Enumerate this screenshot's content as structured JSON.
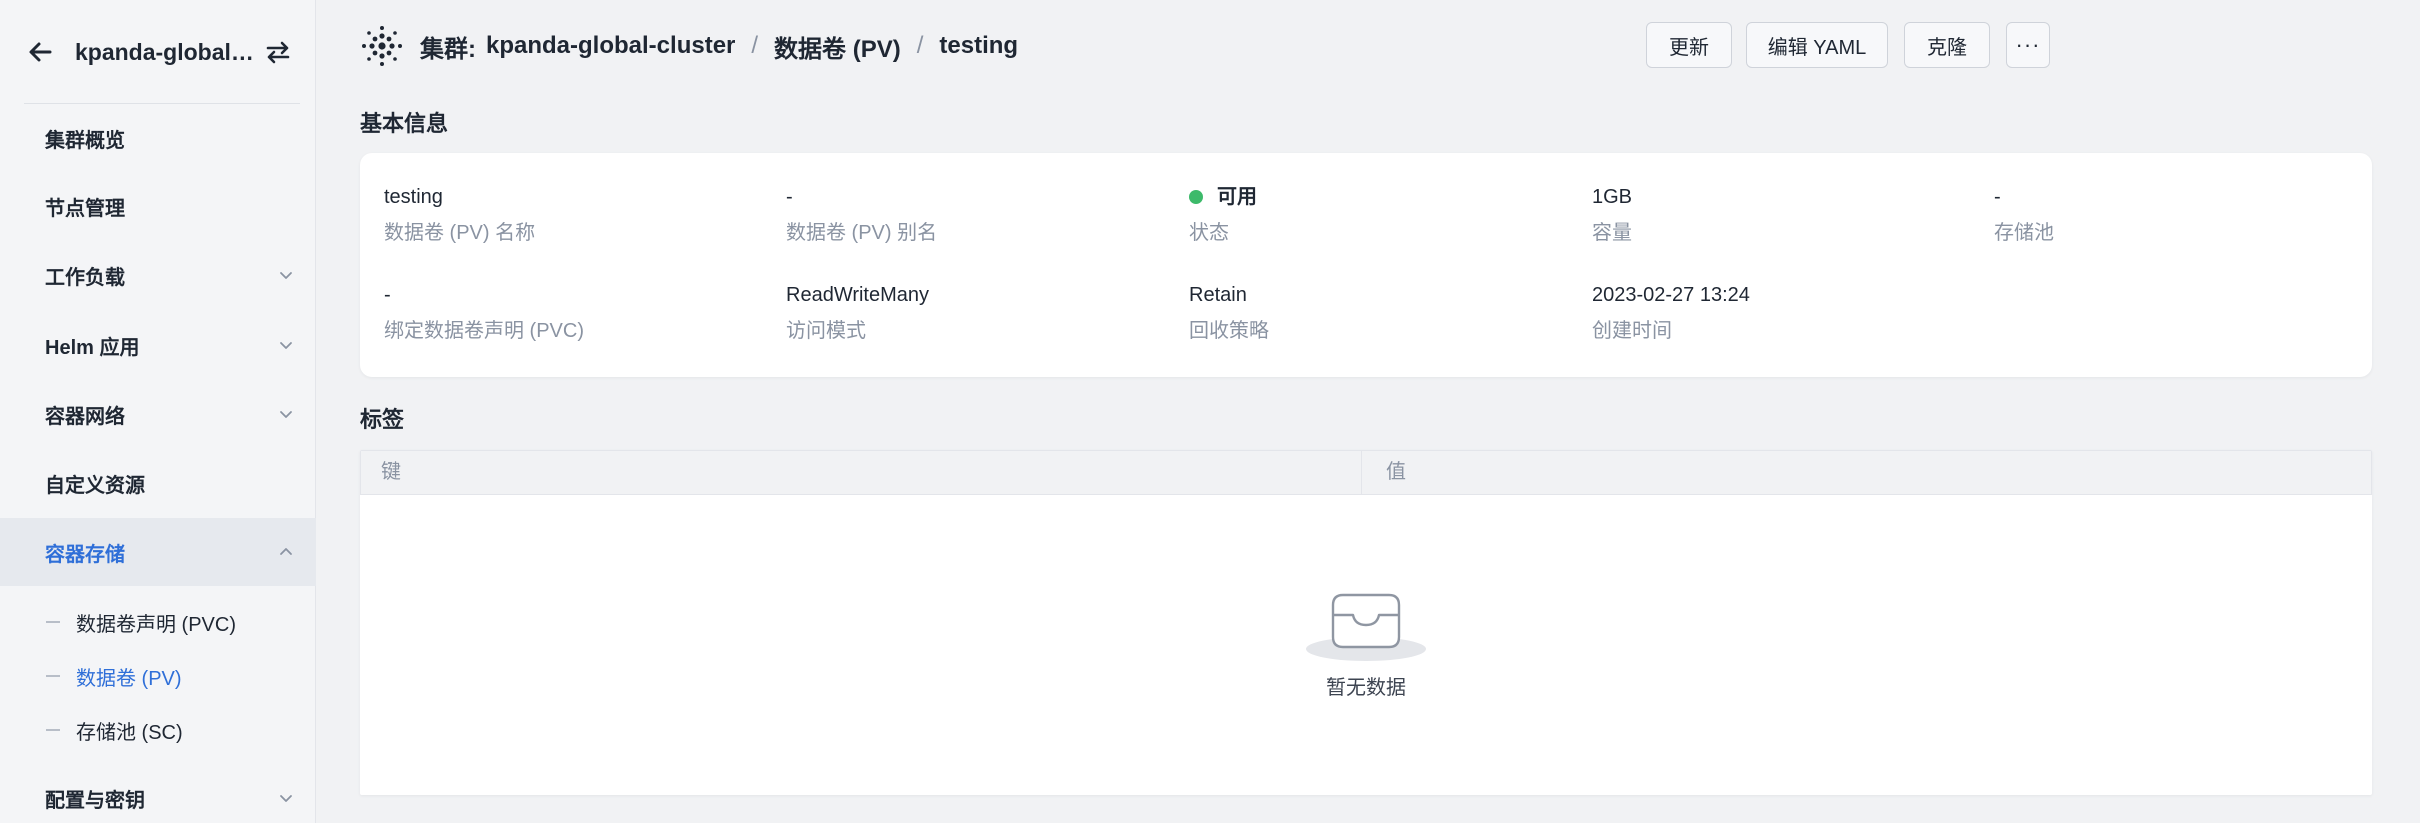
{
  "sidebar": {
    "cluster_name": "kpanda-global-...",
    "items": [
      {
        "label": "集群概览"
      },
      {
        "label": "节点管理"
      },
      {
        "label": "工作负载"
      },
      {
        "label": "Helm 应用"
      },
      {
        "label": "容器网络"
      },
      {
        "label": "自定义资源"
      },
      {
        "label": "容器存储"
      },
      {
        "label": "配置与密钥"
      }
    ],
    "sub_items": [
      {
        "label": "数据卷声明 (PVC)"
      },
      {
        "label": "数据卷 (PV)"
      },
      {
        "label": "存储池 (SC)"
      }
    ]
  },
  "breadcrumb": {
    "prefix": "集群:",
    "cluster": "kpanda-global-cluster",
    "section": "数据卷 (PV)",
    "current": "testing",
    "separator": "/"
  },
  "toolbar": {
    "update": "更新",
    "edit_yaml": "编辑 YAML",
    "clone": "克隆",
    "more": "···"
  },
  "basic_info": {
    "title": "基本信息",
    "fields": [
      {
        "value": "testing",
        "label": "数据卷 (PV) 名称"
      },
      {
        "value": "-",
        "label": "数据卷 (PV) 别名"
      },
      {
        "value": "可用",
        "label": "状态",
        "status_color": "#3dba6a"
      },
      {
        "value": "1GB",
        "label": "容量"
      },
      {
        "value": "-",
        "label": "存储池"
      },
      {
        "value": "-",
        "label": "绑定数据卷声明 (PVC)"
      },
      {
        "value": "ReadWriteMany",
        "label": "访问模式"
      },
      {
        "value": "Retain",
        "label": "回收策略"
      },
      {
        "value": "2023-02-27 13:24",
        "label": "创建时间"
      }
    ]
  },
  "labels": {
    "title": "标签",
    "columns": [
      "键",
      "值"
    ],
    "empty_text": "暂无数据"
  },
  "colors": {
    "accent": "#2f6fd8",
    "status_available": "#3dba6a"
  },
  "icons": {
    "back": "arrow-left-icon",
    "switch": "switch-arrows-icon",
    "logo": "cluster-logo-icon",
    "chevron_down": "chevron-down-icon",
    "chevron_up": "chevron-up-icon",
    "empty": "empty-inbox-icon"
  }
}
